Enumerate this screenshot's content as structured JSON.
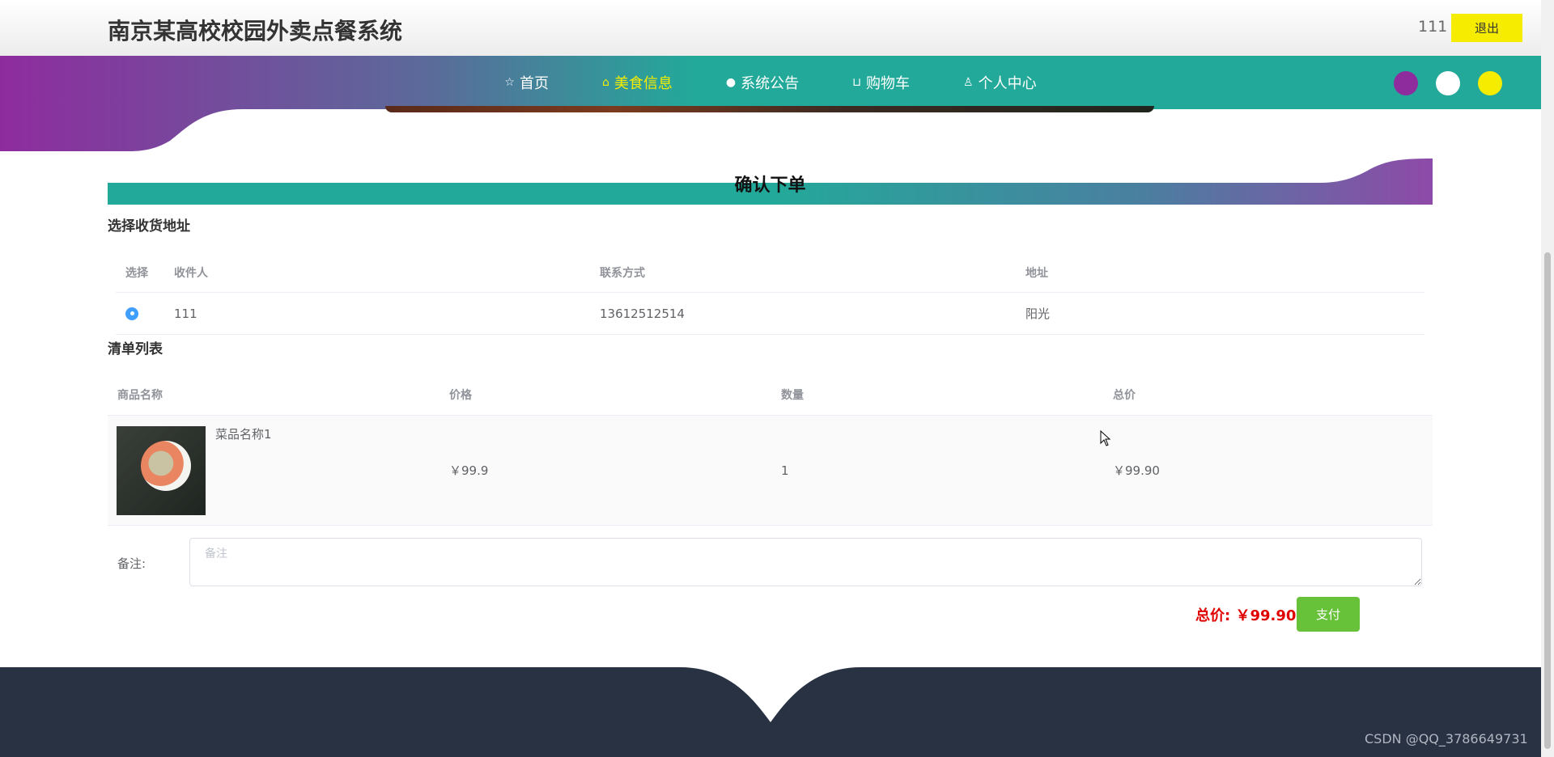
{
  "header": {
    "site_title": "南京某高校校园外卖点餐系统",
    "username": "111",
    "logout_label": "退出"
  },
  "nav": {
    "items": [
      {
        "label": "首页",
        "icon": "star-icon",
        "active": false
      },
      {
        "label": "美食信息",
        "icon": "bag-icon",
        "active": true
      },
      {
        "label": "系统公告",
        "icon": "info-circle-icon",
        "active": false
      },
      {
        "label": "购物车",
        "icon": "cart-icon",
        "active": false
      },
      {
        "label": "个人中心",
        "icon": "user-icon",
        "active": false
      }
    ],
    "active_color": "#f6ec00"
  },
  "theme_colors": [
    "#8e2c9e",
    "#ffffff",
    "#f6ec00"
  ],
  "page": {
    "title": "确认下单",
    "address_section_title": "选择收货地址",
    "items_section_title": "清单列表"
  },
  "address_table": {
    "headers": [
      "选择",
      "收件人",
      "联系方式",
      "地址"
    ],
    "rows": [
      {
        "selected": true,
        "recipient": "111",
        "phone": "13612512514",
        "address": "阳光"
      }
    ]
  },
  "items_table": {
    "headers": [
      "商品名称",
      "价格",
      "数量",
      "总价"
    ],
    "rows": [
      {
        "name": "菜品名称1",
        "price": "￥99.9",
        "quantity": "1",
        "total": "￥99.90"
      }
    ]
  },
  "remark": {
    "label": "备注:",
    "placeholder": "备注",
    "value": ""
  },
  "summary": {
    "total_label": "总价: ￥99.90",
    "pay_label": "支付"
  },
  "watermark": "CSDN @QQ_3786649731",
  "colors": {
    "teal": "#23a99a",
    "purple": "#8e2c9e",
    "footer": "#283243",
    "pay_green": "#67c23a",
    "total_red": "#e10000"
  }
}
